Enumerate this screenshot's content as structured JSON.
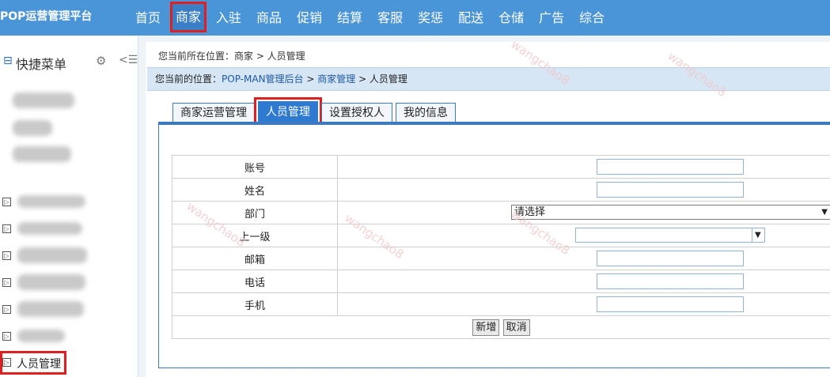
{
  "header": {
    "brand": "POP运营管理平台",
    "nav": [
      "首页",
      "商家",
      "入驻",
      "商品",
      "促销",
      "结算",
      "客服",
      "奖惩",
      "配送",
      "仓储",
      "广告",
      "综合"
    ],
    "active_index": 1
  },
  "sidebar": {
    "quick_title": "快捷菜单",
    "collapse_toggle": "⊟",
    "active_item": "人员管理"
  },
  "content": {
    "location_top": "您当前所在位置：商家 > 人员管理",
    "location_prefix": "您当前的位置：",
    "location_link1": "POP-MAN管理后台",
    "location_sep1": " > ",
    "location_link2": "商家管理",
    "location_sep2": " > 人员管理",
    "tabs": [
      "商家运营管理",
      "人员管理",
      "设置授权人",
      "我的信息"
    ],
    "form": {
      "account_label": "账号",
      "name_label": "姓名",
      "dept_label": "部门",
      "dept_value": "请选择",
      "superior_label": "上一级",
      "superior_value": "",
      "email_label": "邮箱",
      "phone_label": "电话",
      "mobile_label": "手机",
      "add_button": "新增",
      "cancel_button": "取消"
    },
    "watermark": "wangchao8"
  }
}
